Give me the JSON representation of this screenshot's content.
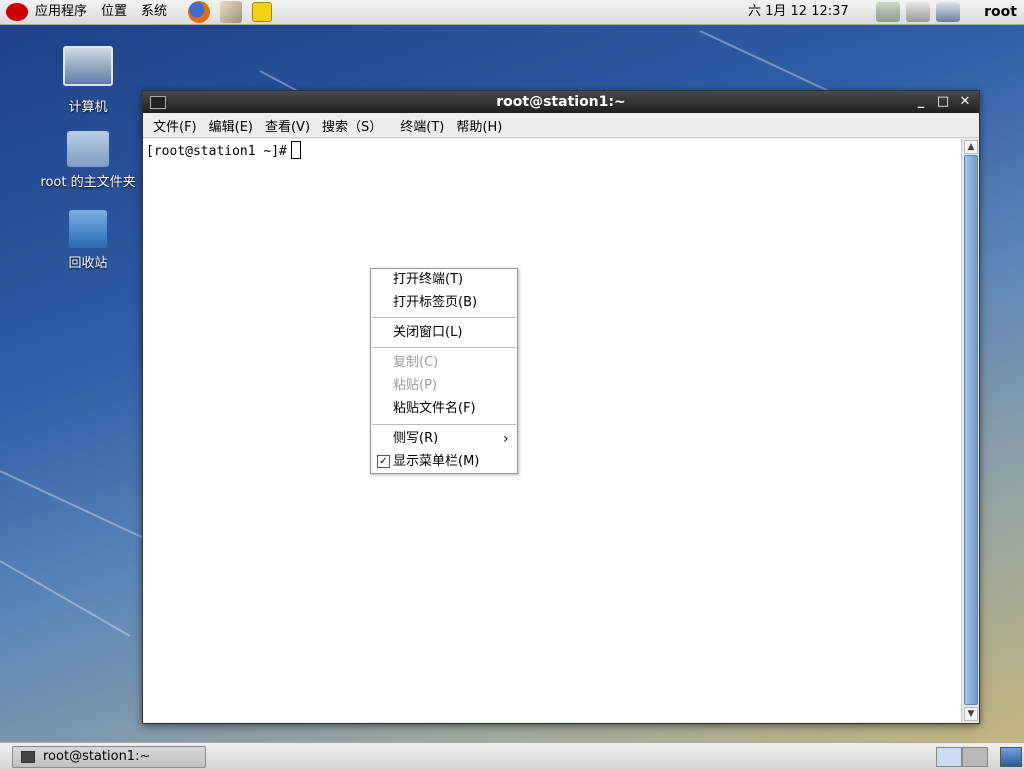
{
  "top_panel": {
    "menus": [
      "应用程序",
      "位置",
      "系统"
    ],
    "clock": "六 1月 12 12:37",
    "user": "root"
  },
  "desktop": {
    "icons": [
      {
        "label": "计算机",
        "icon": "computer-icon"
      },
      {
        "label": "root 的主文件夹",
        "icon": "home-folder-icon"
      },
      {
        "label": "回收站",
        "icon": "trash-icon"
      }
    ]
  },
  "terminal": {
    "title": "root@station1:~",
    "menus": [
      "文件(F)",
      "编辑(E)",
      "查看(V)",
      "搜索（S）",
      "终端(T)",
      "帮助(H)"
    ],
    "prompt": "[root@station1 ~]#"
  },
  "context_menu": {
    "items": [
      {
        "label": "打开终端(T)",
        "enabled": true
      },
      {
        "label": "打开标签页(B)",
        "enabled": true
      },
      {
        "label": "关闭窗口(L)",
        "enabled": true
      },
      {
        "label": "复制(C)",
        "enabled": false
      },
      {
        "label": "粘贴(P)",
        "enabled": false
      },
      {
        "label": "粘贴文件名(F)",
        "enabled": true
      },
      {
        "label": "侧写(R)",
        "enabled": true,
        "submenu": true
      },
      {
        "label": "显示菜单栏(M)",
        "enabled": true,
        "checked": true
      }
    ]
  },
  "taskbar": {
    "window_button": "root@station1:~"
  }
}
